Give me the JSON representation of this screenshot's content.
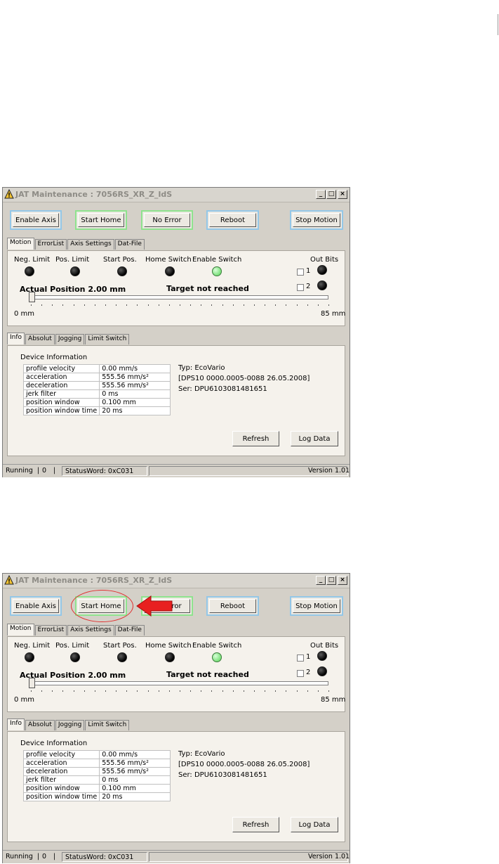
{
  "window": {
    "title": "JAT Maintenance : 7056RS_XR_Z_IdS",
    "controls": {
      "minimize": "_",
      "maximize": "□",
      "close": "×"
    }
  },
  "toolbar": {
    "enable_axis": "Enable Axis",
    "start_home": "Start Home",
    "no_error": "No Error",
    "reboot": "Reboot",
    "stop_motion": "Stop Motion"
  },
  "top_tabs": [
    "Motion",
    "ErrorList",
    "Axis Settings",
    "Dat-File"
  ],
  "indicators": [
    {
      "label": "Neg. Limit",
      "state": "off"
    },
    {
      "label": "Pos. Limit",
      "state": "off"
    },
    {
      "label": "Start Pos.",
      "state": "off"
    },
    {
      "label": "Home Switch",
      "state": "off"
    },
    {
      "label": "Enable Switch",
      "state": "on"
    }
  ],
  "out_bits": {
    "label": "Out Bits",
    "bits": [
      "1",
      "2"
    ]
  },
  "position": {
    "actual": "Actual Position 2.00 mm",
    "target_status": "Target not reached",
    "min_label": "0 mm",
    "max_label": "85 mm"
  },
  "bottom_tabs": [
    "Info",
    "Absolut",
    "Jogging",
    "Limit Switch"
  ],
  "device_info": {
    "heading": "Device Information",
    "rows": [
      [
        "profile velocity",
        "0.00 mm/s"
      ],
      [
        "acceleration",
        "555.56 mm/s²"
      ],
      [
        "deceleration",
        "555.56 mm/s²"
      ],
      [
        "jerk filter",
        "0 ms"
      ],
      [
        "position window",
        "0.100 mm"
      ],
      [
        "position window time",
        "20 ms"
      ]
    ],
    "typ": "Typ: EcoVario",
    "firmware": "[DPS10 0000.0005-0088 26.05.2008]",
    "serial": "Ser: DPU6103081481651"
  },
  "actions": {
    "refresh": "Refresh",
    "log_data": "Log Data"
  },
  "status_bar": {
    "state": "Running",
    "count": "0",
    "status_word": "StatusWord: 0xC031",
    "version": "Version 1.01"
  },
  "colors": {
    "accent_blue": "#93c7e8",
    "accent_green": "#8ee38e",
    "led_on": "#7be07b",
    "annotation_red": "#e03030"
  }
}
